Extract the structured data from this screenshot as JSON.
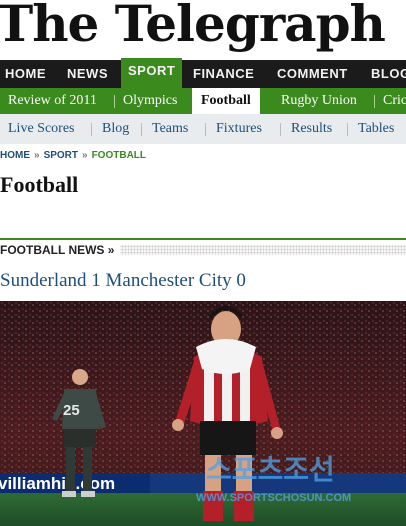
{
  "masthead": {
    "title": "The Telegraph"
  },
  "nav_primary": [
    {
      "label": "HOME"
    },
    {
      "label": "NEWS"
    },
    {
      "label": "SPORT"
    },
    {
      "label": "FINANCE"
    },
    {
      "label": "COMMENT"
    },
    {
      "label": "BLOG"
    }
  ],
  "nav_secondary": [
    {
      "label": "Review of 2011"
    },
    {
      "label": "Olympics"
    },
    {
      "label": "Football"
    },
    {
      "label": "Rugby Union"
    },
    {
      "label": "Cric"
    }
  ],
  "nav_tertiary": [
    {
      "label": "Live Scores"
    },
    {
      "label": "Blog"
    },
    {
      "label": "Teams"
    },
    {
      "label": "Fixtures"
    },
    {
      "label": "Results"
    },
    {
      "label": "Tables"
    }
  ],
  "breadcrumb": [
    {
      "label": "HOME"
    },
    {
      "label": "SPORT"
    },
    {
      "label": "FOOTBALL"
    }
  ],
  "breadcrumb_separator": "»",
  "page_title": "Football",
  "section": {
    "heading": "FOOTBALL NEWS »"
  },
  "article": {
    "headline": "Sunderland 1 Manchester City 0",
    "photo": {
      "player_number": "25",
      "ad_board_text": "villiamhill.com",
      "watermark_logo": "스포츠조선",
      "watermark_url": "WWW.SPORTSCHOSUN.COM"
    }
  },
  "colors": {
    "accent_green": "#3b8a1e",
    "link_blue": "#1f4e79",
    "nav_dark": "#1b1b1b",
    "subnav_grey": "#e9ecee"
  }
}
